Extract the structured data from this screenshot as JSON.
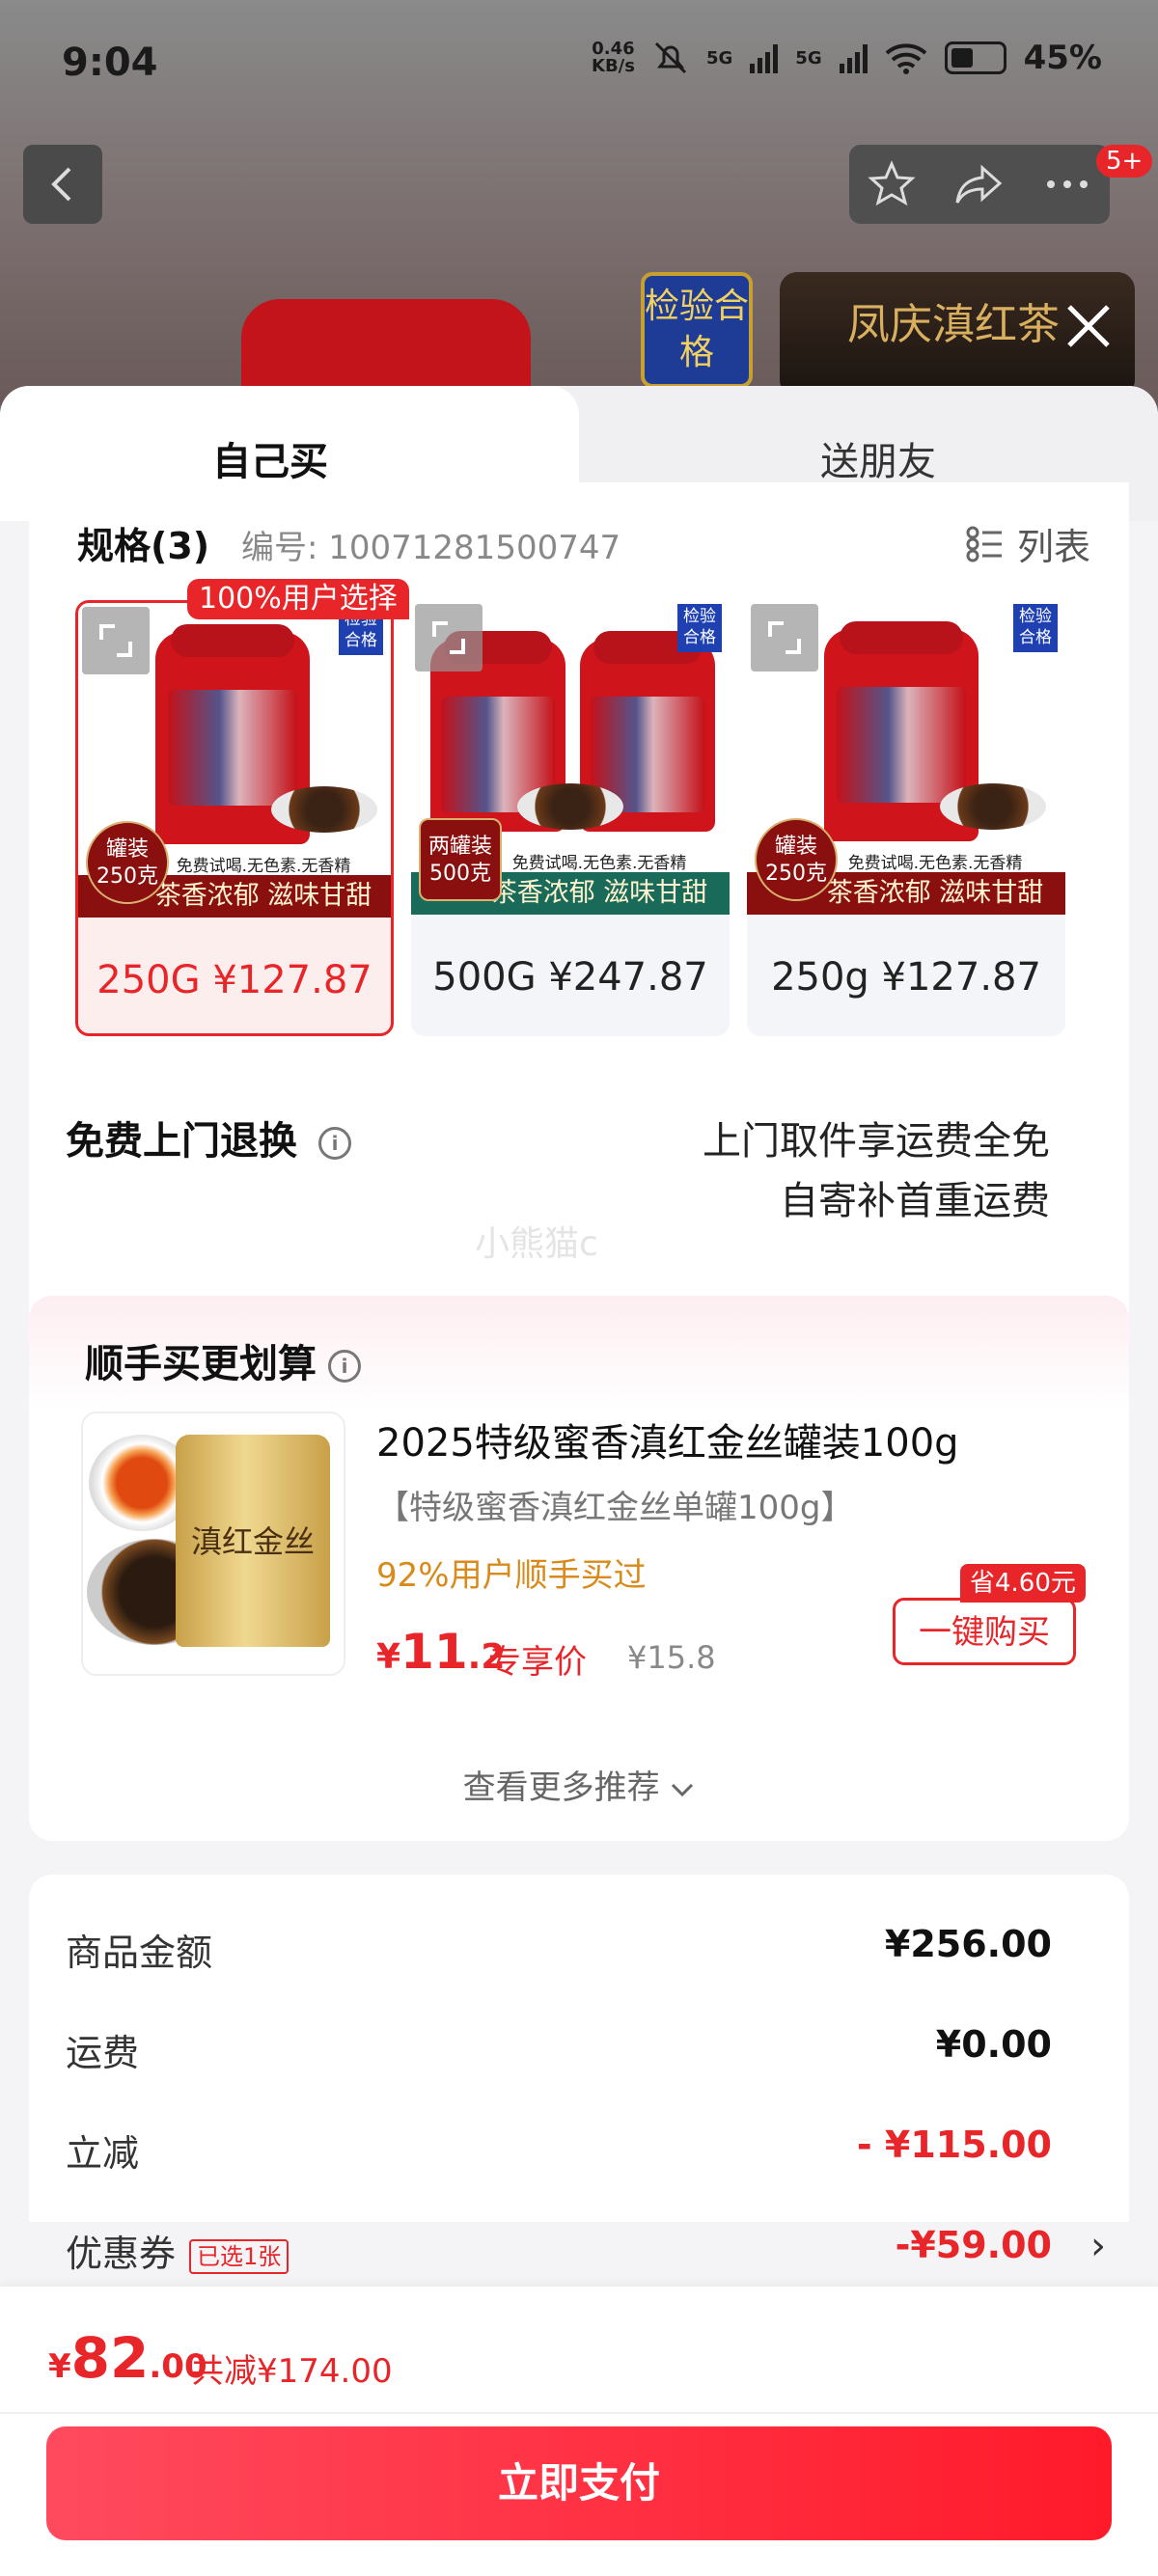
{
  "status_bar": {
    "time": "9:04",
    "net_speed": "0.46",
    "net_unit": "KB/s",
    "signal1": "5G",
    "signal2": "5G",
    "battery": "45%"
  },
  "header": {
    "more_badge": "5+",
    "thumb1_text": "检验合格",
    "thumb2_text": "凤庆滇红茶"
  },
  "tabs": {
    "self": "自己买",
    "friend": "送朋友"
  },
  "spec": {
    "title": "规格(3)",
    "code": "编号: 10071281500747",
    "list_view": "列表",
    "options": [
      {
        "label": "250G ¥127.87",
        "badge": "100%用户选择",
        "qc": "检验合格",
        "banner": "茶香浓郁 滋味甘甜",
        "subbanner": "免费试喝.无色素.无香精",
        "tag": "罐装250克",
        "selected": true
      },
      {
        "label": "500G ¥247.87",
        "qc": "检验合格",
        "banner": "茶香浓郁 滋味甘甜",
        "subbanner": "免费试喝.无色素.无香精",
        "tag": "两罐装500克",
        "selected": false
      },
      {
        "label": "250g ¥127.87",
        "qc": "检验合格",
        "banner": "茶香浓郁 滋味甘甜",
        "subbanner": "免费试喝.无色素.无香精",
        "tag": "罐装250克",
        "selected": false
      }
    ]
  },
  "return_service": {
    "title": "免费上门退换",
    "line1": "上门取件享运费全免",
    "line2": "自寄补首重运费"
  },
  "watermark": "小熊猫c",
  "upsell": {
    "title": "顺手买更划算",
    "name": "2025特级蜜香滇红金丝罐装100g",
    "sku": "【特级蜜香滇红金丝单罐100g】",
    "pct": "92%用户顺手买过",
    "price_yen": "¥",
    "price_int": "11",
    "price_dec": ".2",
    "price_label": "专享价",
    "orig_price": "¥15.8",
    "save_tag": "省4.60元",
    "buy_btn": "一键购买",
    "can_text": "滇红金丝",
    "more": "查看更多推荐"
  },
  "summary": {
    "rows": [
      {
        "label": "商品金额",
        "value": "¥256.00"
      },
      {
        "label": "运费",
        "value": "¥0.00"
      },
      {
        "label": "立减",
        "value": "- ¥115.00"
      },
      {
        "label": "优惠券",
        "tag": "已选1张",
        "value": "-¥59.00"
      }
    ]
  },
  "footer": {
    "yen": "¥",
    "total_int": "82",
    "total_dec": ".00",
    "saved": "共减¥174.00",
    "pay": "立即支付"
  }
}
